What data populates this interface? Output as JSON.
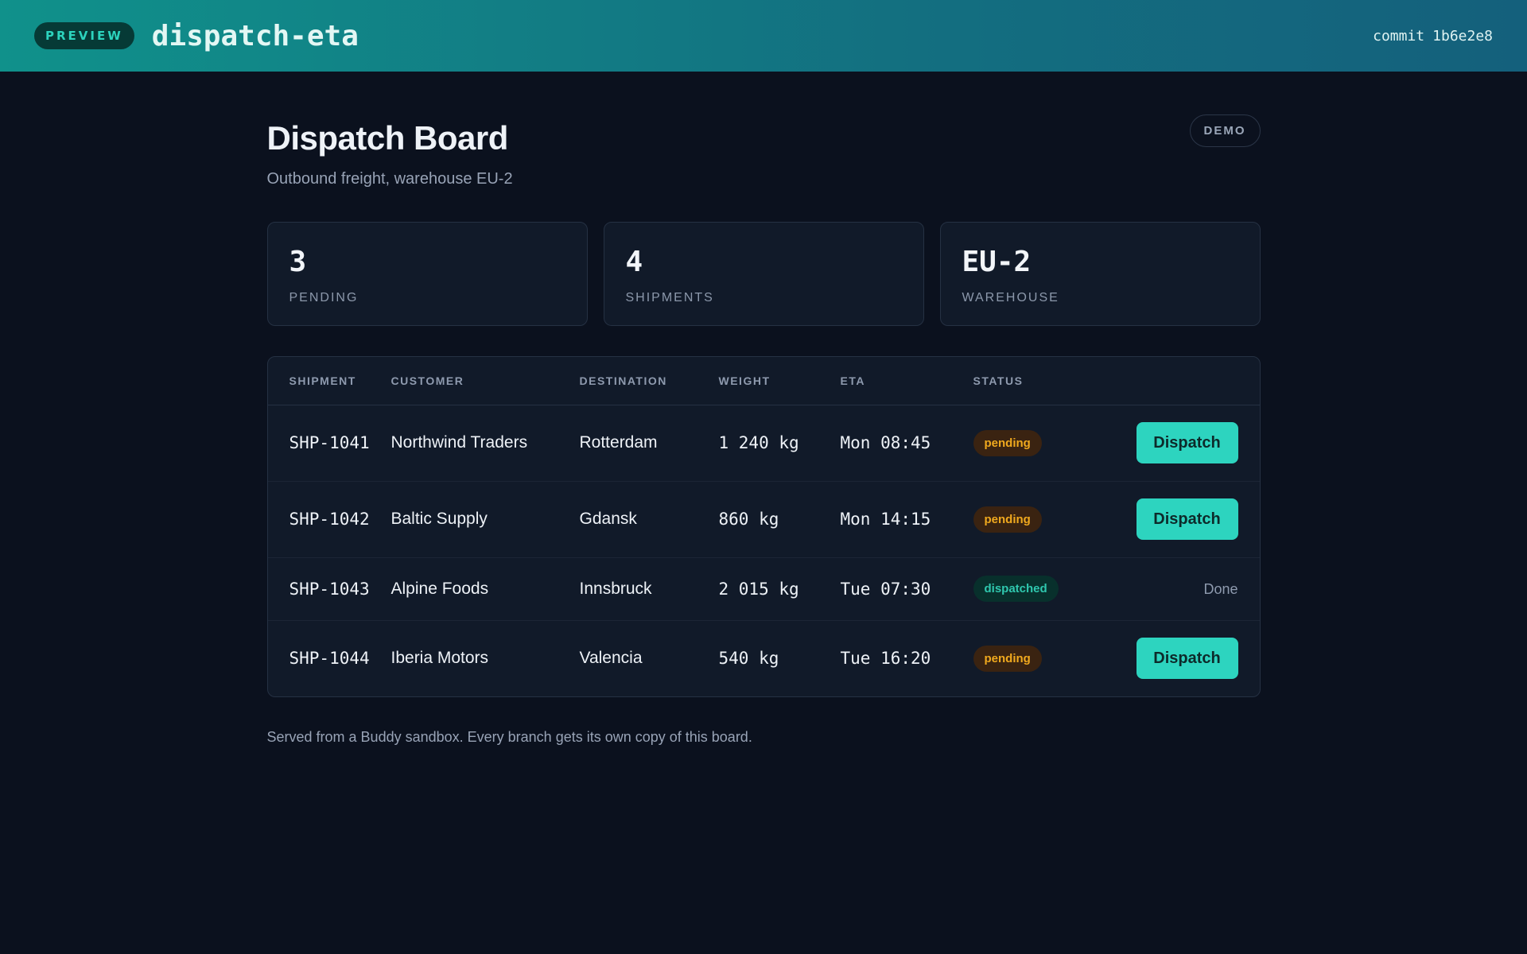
{
  "topbar": {
    "preview_label": "PREVIEW",
    "app_name": "dispatch-eta",
    "commit_label": "commit",
    "commit_hash": "1b6e2e8"
  },
  "page": {
    "title": "Dispatch Board",
    "subtitle": "Outbound freight, warehouse EU-2",
    "demo_badge": "DEMO"
  },
  "stats": [
    {
      "value": "3",
      "label": "PENDING"
    },
    {
      "value": "4",
      "label": "SHIPMENTS"
    },
    {
      "value": "EU-2",
      "label": "WAREHOUSE"
    }
  ],
  "table": {
    "headers": [
      "SHIPMENT",
      "CUSTOMER",
      "DESTINATION",
      "WEIGHT",
      "ETA",
      "STATUS",
      ""
    ],
    "rows": [
      {
        "shipment": "SHP-1041",
        "customer": "Northwind Traders",
        "destination": "Rotterdam",
        "weight": "1 240 kg",
        "eta": "Mon 08:45",
        "status": "pending",
        "action": "Dispatch"
      },
      {
        "shipment": "SHP-1042",
        "customer": "Baltic Supply",
        "destination": "Gdansk",
        "weight": "860 kg",
        "eta": "Mon 14:15",
        "status": "pending",
        "action": "Dispatch"
      },
      {
        "shipment": "SHP-1043",
        "customer": "Alpine Foods",
        "destination": "Innsbruck",
        "weight": "2 015 kg",
        "eta": "Tue 07:30",
        "status": "dispatched",
        "action": "Done"
      },
      {
        "shipment": "SHP-1044",
        "customer": "Iberia Motors",
        "destination": "Valencia",
        "weight": "540 kg",
        "eta": "Tue 16:20",
        "status": "pending",
        "action": "Dispatch"
      }
    ]
  },
  "footer": {
    "note": "Served from a Buddy sandbox. Every branch gets its own copy of this board."
  },
  "colors": {
    "accent": "#2dd4bf",
    "pending": "#f0a91e",
    "dispatched": "#2fc7ae",
    "background": "#0b111e"
  }
}
